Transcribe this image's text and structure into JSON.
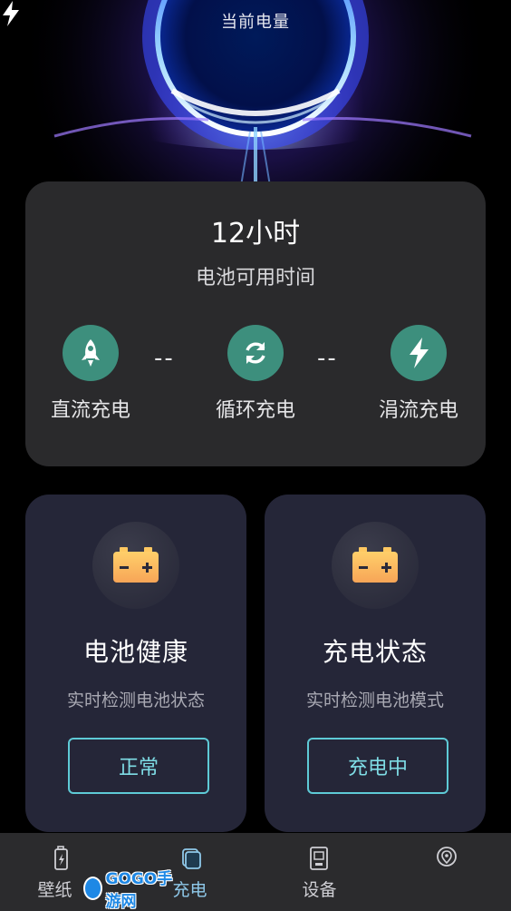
{
  "hero": {
    "title": "当前电量"
  },
  "battery_time": {
    "value": "12小时",
    "label": "电池可用时间"
  },
  "charge_modes": [
    {
      "label": "直流充电",
      "icon": "rocket-icon"
    },
    {
      "label": "循环充电",
      "icon": "cycle-icon"
    },
    {
      "label": "涓流充电",
      "icon": "bolt-icon"
    }
  ],
  "separator": "--",
  "cards": [
    {
      "title": "电池健康",
      "subtitle": "实时检测电池状态",
      "status": "正常",
      "icon": "battery-icon"
    },
    {
      "title": "充电状态",
      "subtitle": "实时检测电池模式",
      "status": "充电中",
      "icon": "battery-icon"
    }
  ],
  "nav": [
    {
      "label": "壁纸",
      "icon": "wallpaper-icon"
    },
    {
      "label": "充电",
      "icon": "charge-icon"
    },
    {
      "label": "设备",
      "icon": "device-icon"
    },
    {
      "label": "",
      "icon": "location-icon"
    }
  ],
  "watermark": {
    "text": "GOGO手游网"
  },
  "colors": {
    "accent_teal": "#3d8f7d",
    "button_border": "#5ecad6",
    "card_bg": "#2a2a2c",
    "feature_card_bg": "#252638"
  }
}
